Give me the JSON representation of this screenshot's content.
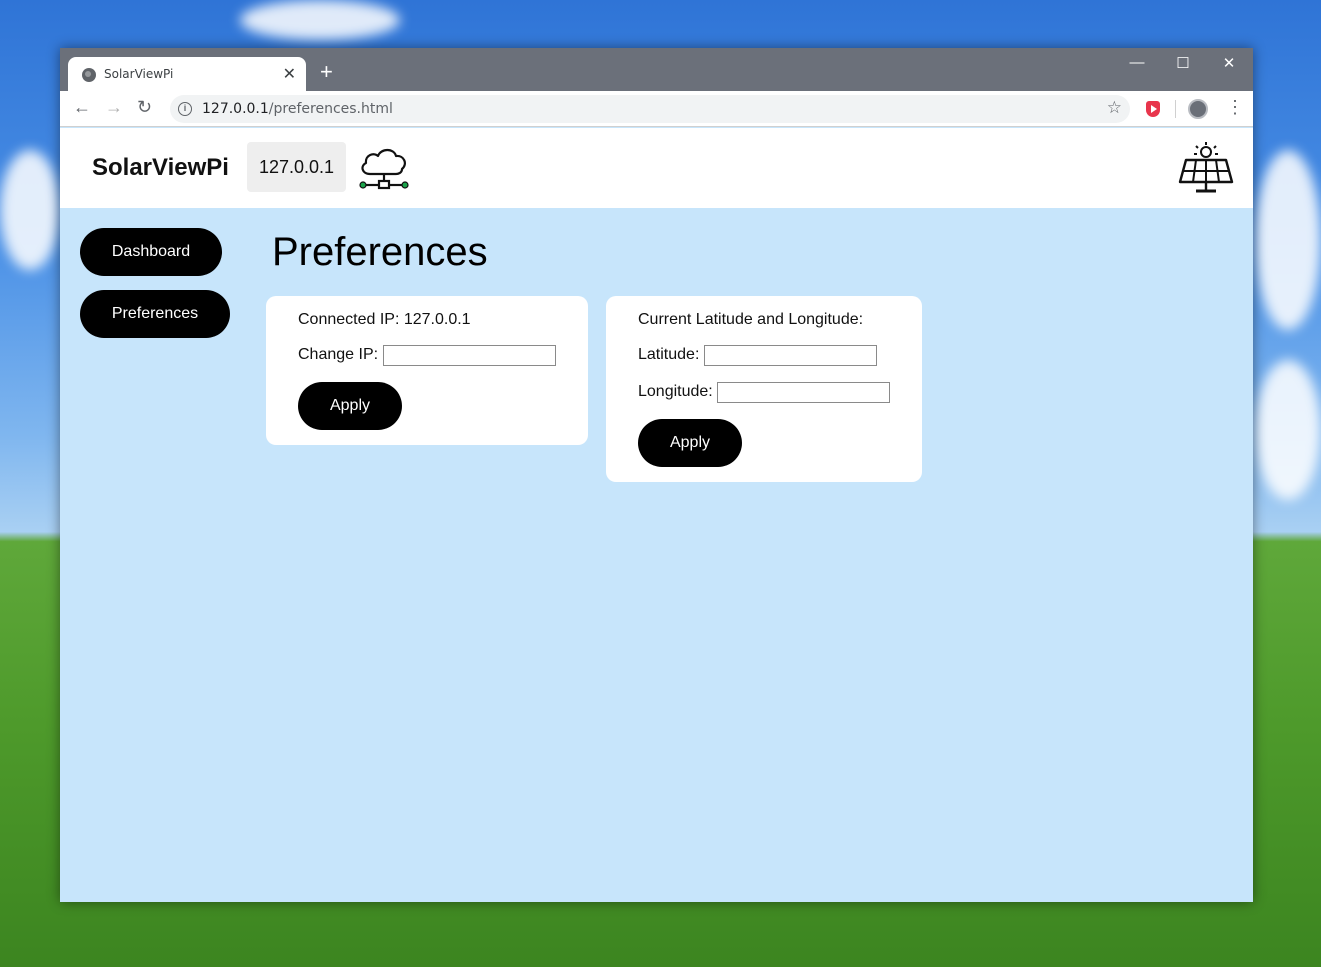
{
  "browser": {
    "tab_title": "SolarViewPi",
    "tab_close": "✕",
    "new_tab": "+",
    "url_host": "127.0.0.1",
    "url_path": "/preferences.html",
    "controls": {
      "minimize": "—",
      "maximize": "☐",
      "close": "✕"
    },
    "nav": {
      "back": "←",
      "forward": "→",
      "reload": "↻"
    },
    "star": "☆",
    "menu": "⋮",
    "info": "i"
  },
  "header": {
    "brand": "SolarViewPi",
    "ip_badge": "127.0.0.1",
    "cloud_icon": "cloud-network-icon",
    "solar_icon": "solar-panel-icon"
  },
  "sidebar": {
    "items": [
      {
        "label": "Dashboard"
      },
      {
        "label": "Preferences"
      }
    ]
  },
  "main": {
    "title": "Preferences",
    "ip_card": {
      "connected_label": "Connected IP: 127.0.0.1",
      "change_label": "Change IP:",
      "change_value": "",
      "apply_label": "Apply"
    },
    "location_card": {
      "heading": "Current Latitude and Longitude:",
      "latitude_label": "Latitude:",
      "latitude_value": "",
      "longitude_label": "Longitude:",
      "longitude_value": "",
      "apply_label": "Apply"
    }
  },
  "colors": {
    "page_background": "#c7e5fb",
    "header_background": "#ffffff",
    "button": "#000000",
    "accent_green": "#1aa34a"
  }
}
